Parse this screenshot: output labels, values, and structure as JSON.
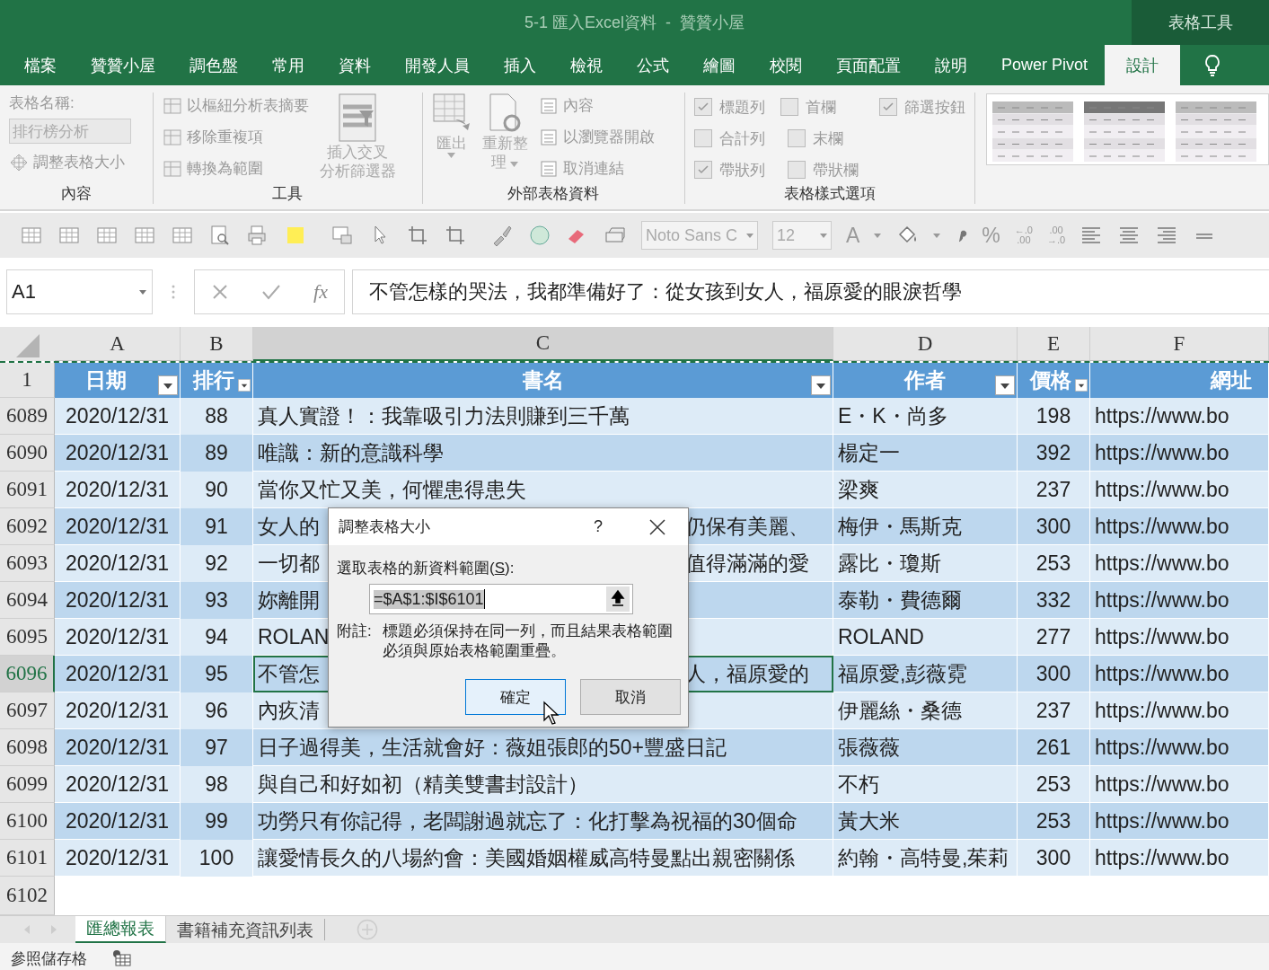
{
  "title_bar": {
    "title": "5-1 匯入Excel資料  -  贊贊小屋",
    "context": "表格工具"
  },
  "tabs": [
    {
      "label": "檔案",
      "selected": false
    },
    {
      "label": "贊贊小屋",
      "selected": false
    },
    {
      "label": "調色盤",
      "selected": false
    },
    {
      "label": "常用",
      "selected": false
    },
    {
      "label": "資料",
      "selected": false
    },
    {
      "label": "開發人員",
      "selected": false
    },
    {
      "label": "插入",
      "selected": false
    },
    {
      "label": "檢視",
      "selected": false
    },
    {
      "label": "公式",
      "selected": false
    },
    {
      "label": "繪圖",
      "selected": false
    },
    {
      "label": "校閱",
      "selected": false
    },
    {
      "label": "頁面配置",
      "selected": false
    },
    {
      "label": "說明",
      "selected": false
    },
    {
      "label": "Power Pivot",
      "selected": false
    },
    {
      "label": "設計",
      "selected": true
    }
  ],
  "ribbon": {
    "properties": {
      "label": "內容",
      "name_label": "表格名稱:",
      "name_value": "排行榜分析",
      "resize": "調整表格大小"
    },
    "tools": {
      "label": "工具",
      "items": [
        "以樞紐分析表摘要",
        "移除重複項",
        "轉換為範圍"
      ],
      "slicer": [
        "插入交叉",
        "分析篩選器"
      ]
    },
    "external": {
      "label": "外部表格資料",
      "export": "匯出",
      "refresh": [
        "重新整",
        "理"
      ],
      "items": [
        "內容",
        "以瀏覽器開啟",
        "取消連結"
      ]
    },
    "style_options": {
      "label": "表格樣式選項",
      "rows": [
        [
          {
            "label": "標題列",
            "checked": true
          },
          {
            "label": "首欄",
            "checked": false
          },
          {
            "label": "篩選按鈕",
            "checked": true
          }
        ],
        [
          {
            "label": "合計列",
            "checked": false
          },
          {
            "label": "末欄",
            "checked": false
          }
        ],
        [
          {
            "label": "帶狀列",
            "checked": true
          },
          {
            "label": "帶狀欄",
            "checked": false
          }
        ]
      ]
    }
  },
  "toolbar": {
    "font": "Noto Sans C",
    "size": "12",
    "font_color": "A",
    "percent": "%",
    "inc_decimal": [
      "←.0",
      ".00"
    ],
    "dec_decimal": [
      ".00",
      "→.0"
    ]
  },
  "formula_bar": {
    "name_box": "A1",
    "fx": "fx",
    "value": "不管怎樣的哭法，我都準備好了：從女孩到女人，福原愛的眼淚哲學"
  },
  "sheet": {
    "columns": [
      {
        "label": "A",
        "selected": false
      },
      {
        "label": "B",
        "selected": false
      },
      {
        "label": "C",
        "selected": true
      },
      {
        "label": "D",
        "selected": false
      },
      {
        "label": "E",
        "selected": false
      },
      {
        "label": "F",
        "selected": false
      }
    ],
    "header_row": "1",
    "headers": [
      {
        "label": "日期",
        "filter": true
      },
      {
        "label": "排行",
        "filter": true
      },
      {
        "label": "書名",
        "filter": true
      },
      {
        "label": "作者",
        "filter": true
      },
      {
        "label": "價格",
        "filter": true
      },
      {
        "label": "網址",
        "filter": false
      }
    ],
    "rows": [
      {
        "num": "6089",
        "active": false,
        "a": "2020/12/31",
        "b": "88",
        "c": "真人實證！：我靠吸引力法則賺到三千萬",
        "d": "E・K・尚多",
        "e": "198",
        "f": "https://www.bo"
      },
      {
        "num": "6090",
        "active": false,
        "a": "2020/12/31",
        "b": "89",
        "c": "唯識：新的意識科學",
        "d": "楊定一",
        "e": "392",
        "f": "https://www.bo"
      },
      {
        "num": "6091",
        "active": false,
        "a": "2020/12/31",
        "b": "90",
        "c": "當你又忙又美，何懼患得患失",
        "d": "梁爽",
        "e": "237",
        "f": "https://www.bo"
      },
      {
        "num": "6092",
        "active": false,
        "a": "2020/12/31",
        "b": "91",
        "c": "女人的",
        "c_tail": "仍保有美麗、",
        "d": "梅伊・馬斯克",
        "e": "300",
        "f": "https://www.bo"
      },
      {
        "num": "6093",
        "active": false,
        "a": "2020/12/31",
        "b": "92",
        "c": "一切都",
        "c_tail": "值得滿滿的愛",
        "d": "露比・瓊斯",
        "e": "253",
        "f": "https://www.bo"
      },
      {
        "num": "6094",
        "active": false,
        "a": "2020/12/31",
        "b": "93",
        "c": "妳離開",
        "d": "泰勒・費德爾",
        "e": "332",
        "f": "https://www.bo"
      },
      {
        "num": "6095",
        "active": false,
        "a": "2020/12/31",
        "b": "94",
        "c": "ROLAN",
        "d": "ROLAND",
        "e": "277",
        "f": "https://www.bo"
      },
      {
        "num": "6096",
        "active": true,
        "a": "2020/12/31",
        "b": "95",
        "c": "不管怎",
        "c_tail": "人，福原愛的",
        "d": "福原愛,彭薇霓",
        "e": "300",
        "f": "https://www.bo"
      },
      {
        "num": "6097",
        "active": false,
        "a": "2020/12/31",
        "b": "96",
        "c": "內疚清",
        "d": "伊麗絲・桑德",
        "e": "237",
        "f": "https://www.bo"
      },
      {
        "num": "6098",
        "active": false,
        "a": "2020/12/31",
        "b": "97",
        "c": "日子過得美，生活就會好：薇姐張郎的50+豐盛日記",
        "d": "張薇薇",
        "e": "261",
        "f": "https://www.bo"
      },
      {
        "num": "6099",
        "active": false,
        "a": "2020/12/31",
        "b": "98",
        "c": "與自己和好如初（精美雙書封設計）",
        "d": "不朽",
        "e": "253",
        "f": "https://www.bo"
      },
      {
        "num": "6100",
        "active": false,
        "a": "2020/12/31",
        "b": "99",
        "c": "功勞只有你記得，老闆謝過就忘了：化打擊為祝福的30個命",
        "d": "黃大米",
        "e": "253",
        "f": "https://www.bo"
      },
      {
        "num": "6101",
        "active": false,
        "a": "2020/12/31",
        "b": "100",
        "c": "讓愛情長久的八場約會：美國婚姻權威高特曼點出親密關係",
        "d": "約翰・高特曼,茱莉",
        "e": "300",
        "f": "https://www.bo"
      }
    ],
    "empty_row": "6102"
  },
  "dialog": {
    "title": "調整表格大小",
    "help": "?",
    "label": "選取表格的新資料範圍(",
    "access_key": "S",
    "label_end": "):",
    "range": "=$A$1:$I$6101",
    "note_label": "附註:",
    "note": "標題必須保持在同一列，而且結果表格範圍必須與原始表格範圍重疊。",
    "ok": "確定",
    "cancel": "取消"
  },
  "sheet_tabs": [
    {
      "label": "匯總報表",
      "selected": true
    },
    {
      "label": "書籍補充資訊列表",
      "selected": false
    }
  ],
  "status_bar": {
    "text": "參照儲存格"
  }
}
